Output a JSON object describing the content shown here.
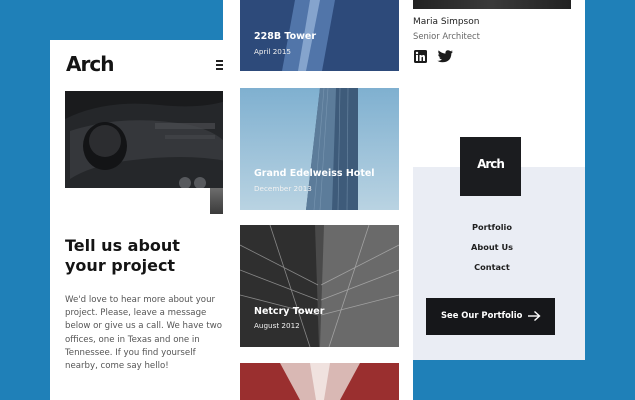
{
  "left_screen": {
    "logo": "Arch",
    "contact_title": "Tell us about your project",
    "contact_body": "We'd love to hear more about your project. Please, leave a message below or give us a call. We have two offices, one in Texas and one in Tennessee. If you find yourself nearby, come say hello!"
  },
  "projects": [
    {
      "name": "228B Tower",
      "date": "April 2015"
    },
    {
      "name": "Grand Edelweiss Hotel",
      "date": "December 2013"
    },
    {
      "name": "Netcry Tower",
      "date": "August 2012"
    }
  ],
  "right_screen": {
    "person_name": "Maria Simpson",
    "person_role": "Senior Architect",
    "footer_logo": "Arch",
    "nav": [
      "Portfolio",
      "About Us",
      "Contact"
    ],
    "cta_label": "See Our Portfolio"
  },
  "icons": [
    "menu-icon",
    "linkedin-icon",
    "twitter-icon",
    "arrow-right-icon"
  ],
  "colors": {
    "background": "#1f80b8",
    "panel": "#ffffff",
    "footer_panel": "#eaedf4",
    "dark": "#16171a"
  }
}
